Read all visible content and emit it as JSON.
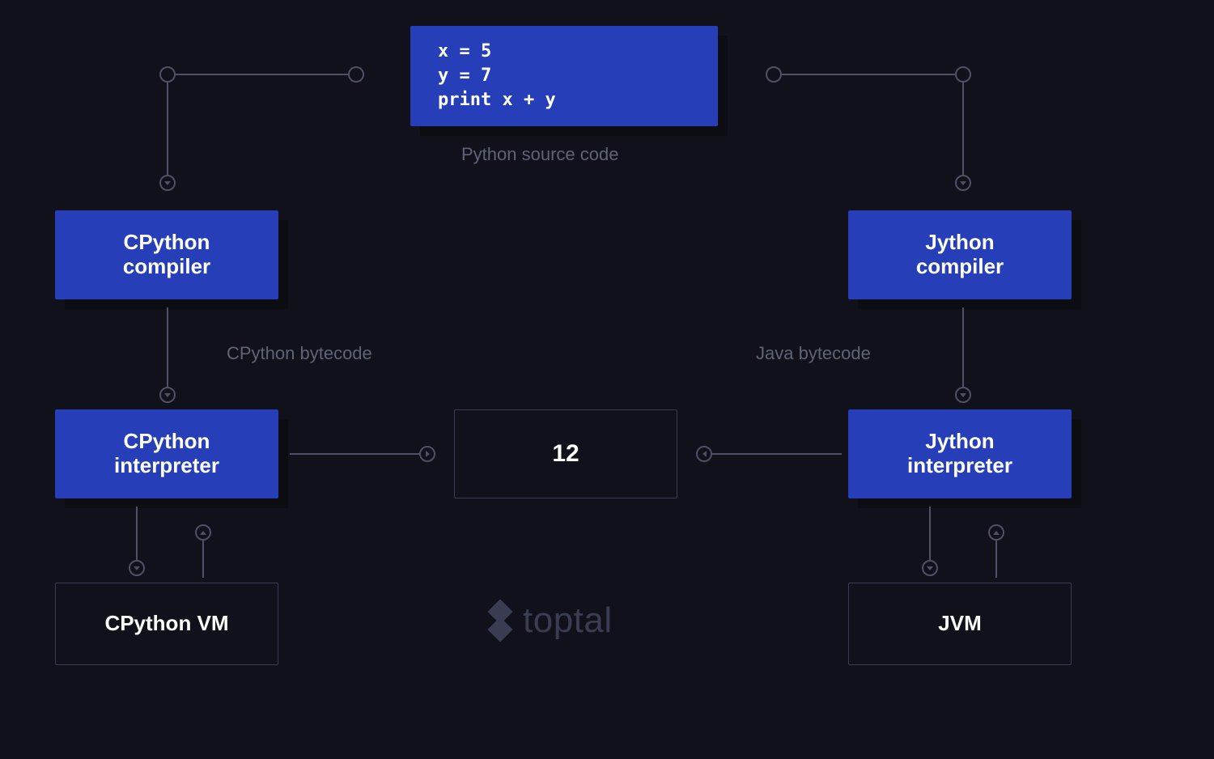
{
  "source": {
    "code": "x = 5\ny = 7\nprint x + y",
    "label": "Python source code"
  },
  "left": {
    "compiler": "CPython compiler",
    "bytecode_label": "CPython bytecode",
    "interpreter": "CPython interpreter",
    "vm": "CPython VM"
  },
  "right": {
    "compiler": "Jython compiler",
    "bytecode_label": "Java bytecode",
    "interpreter": "Jython interpreter",
    "vm": "JVM"
  },
  "output": "12",
  "brand": "toptal",
  "colors": {
    "background": "#10111a",
    "box_fill": "#263fb8",
    "text_white": "#ffffff",
    "muted": "#5f6376",
    "connector": "#4e5166",
    "outline": "#3a3d52"
  }
}
